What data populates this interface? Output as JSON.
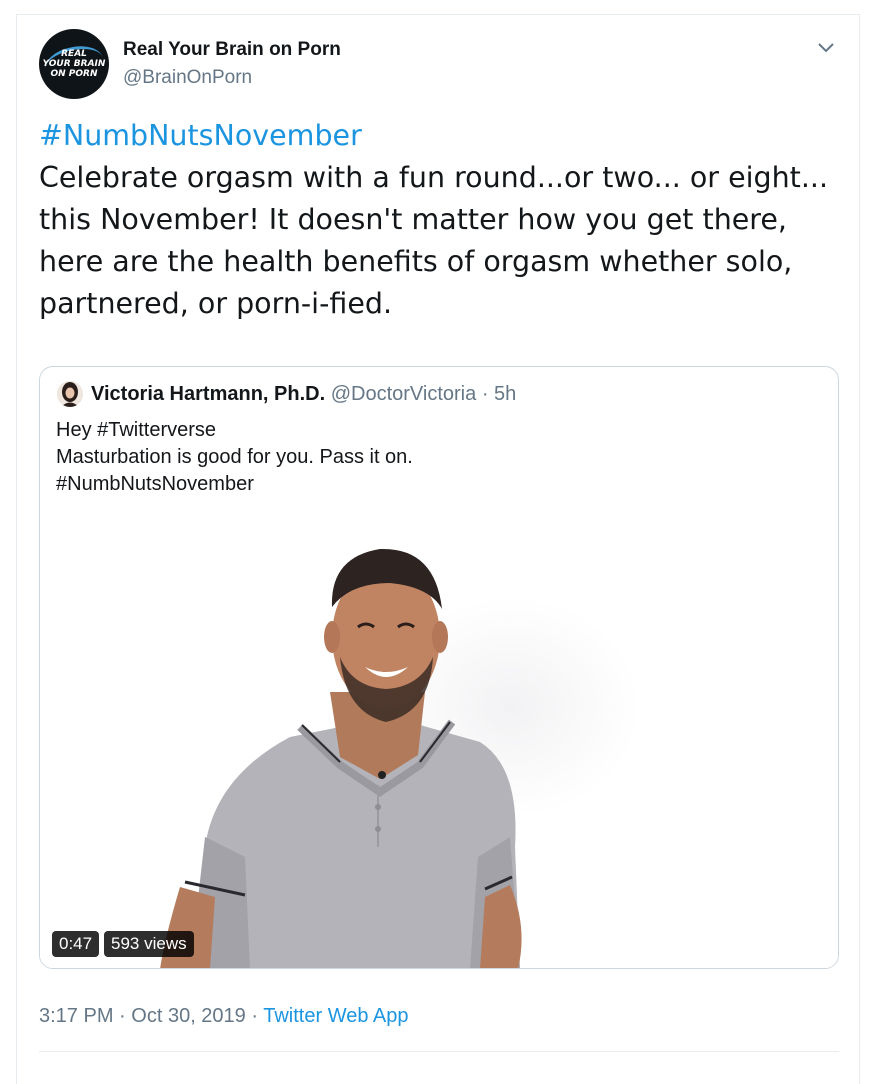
{
  "author": {
    "name": "Real Your Brain on Porn",
    "handle": "@BrainOnPorn",
    "avatar_text": [
      "REAL",
      "YOUR BRAIN",
      "ON PORN"
    ]
  },
  "tweet": {
    "hashtag": "#NumbNutsNovember",
    "lines": [
      "Celebrate orgasm with a fun round...or two... or eight...",
      "this November! It doesn't matter how you get there,",
      "here are the health benefits of orgasm whether solo,",
      "partnered, or porn-i-fied."
    ]
  },
  "quoted_tweet": {
    "name": "Victoria Hartmann, Ph.D.",
    "handle": "@DoctorVictoria",
    "separator": "·",
    "time": "5h",
    "lines": [
      "Hey #Twitterverse",
      "Masturbation is good for you. Pass it on.",
      "#NumbNutsNovember"
    ],
    "video": {
      "duration": "0:47",
      "views": "593 views"
    }
  },
  "footer": {
    "time": "3:17 PM",
    "separator1": "·",
    "date": "Oct 30, 2019",
    "separator2": "·",
    "source": "Twitter Web App"
  },
  "colors": {
    "link": "#1b95e0",
    "secondary_text": "#657786",
    "primary_text": "#14171a",
    "border": "#ccd6dd"
  },
  "icons": [
    "chevron-down-icon"
  ]
}
